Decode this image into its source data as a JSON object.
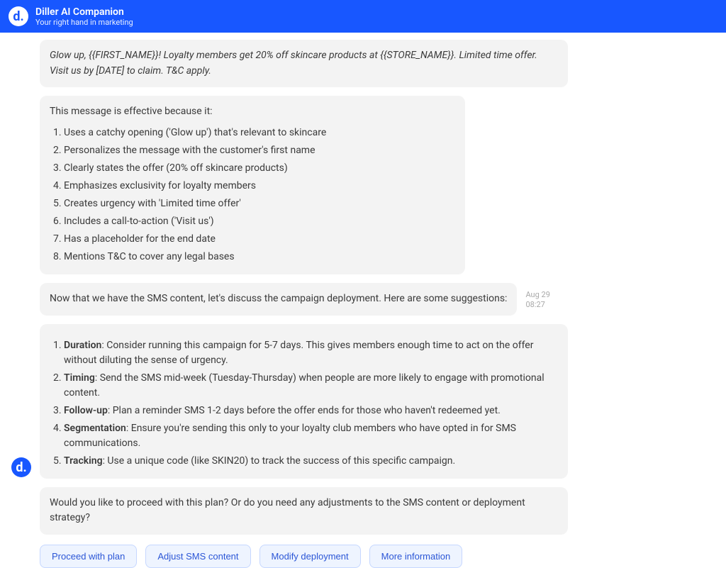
{
  "header": {
    "logo_letter": "d.",
    "title": "Diller AI Companion",
    "subtitle": "Your right hand in marketing"
  },
  "sms_preview": "Glow up, {{FIRST_NAME}}! Loyalty members get 20% off skincare products at {{STORE_NAME}}. Limited time offer. Visit us by [DATE] to claim. T&C apply.",
  "effective": {
    "intro": "This message is effective because it:",
    "points": [
      "Uses a catchy opening ('Glow up') that's relevant to skincare",
      "Personalizes the message with the customer's first name",
      "Clearly states the offer (20% off skincare products)",
      "Emphasizes exclusivity for loyalty members",
      "Creates urgency with 'Limited time offer'",
      "Includes a call-to-action ('Visit us')",
      "Has a placeholder for the end date",
      "Mentions T&C to cover any legal bases"
    ]
  },
  "deploy_intro": {
    "text": "Now that we have the SMS content, let's discuss the campaign deployment. Here are some suggestions:",
    "date": "Aug 29",
    "time": "08:27"
  },
  "suggestions": [
    {
      "label": "Duration",
      "text": ": Consider running this campaign for 5-7 days. This gives members enough time to act on the offer without diluting the sense of urgency."
    },
    {
      "label": "Timing",
      "text": ": Send the SMS mid-week (Tuesday-Thursday) when people are more likely to engage with promotional content."
    },
    {
      "label": "Follow-up",
      "text": ": Plan a reminder SMS 1-2 days before the offer ends for those who haven't redeemed yet."
    },
    {
      "label": "Segmentation",
      "text": ": Ensure you're sending this only to your loyalty club members who have opted in for SMS communications."
    },
    {
      "label": "Tracking",
      "text": ": Use a unique code (like SKIN20) to track the success of this specific campaign."
    }
  ],
  "followup": "Would you like to proceed with this plan? Or do you need any adjustments to the SMS content or deployment strategy?",
  "actions": {
    "proceed": "Proceed with plan",
    "adjust": "Adjust SMS content",
    "modify": "Modify deployment",
    "more": "More information"
  },
  "float_logo": "d."
}
